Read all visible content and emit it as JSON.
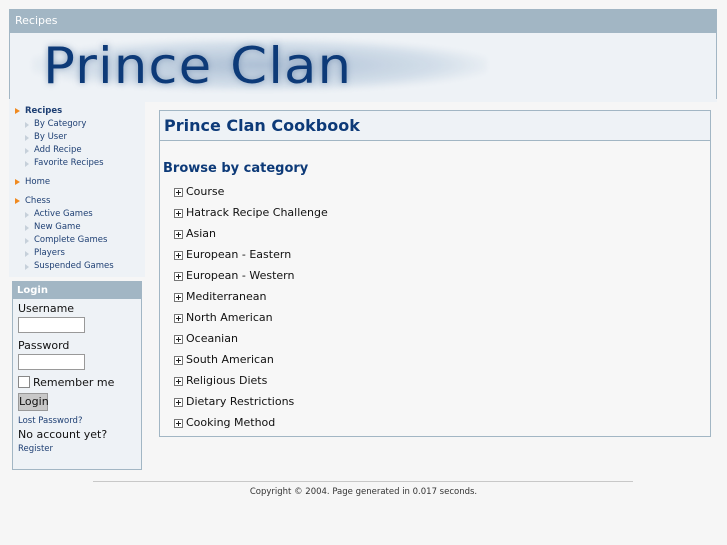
{
  "header": {
    "section_title": "Recipes",
    "banner_text": "Prince Clan"
  },
  "sidebar": {
    "nav": [
      {
        "label": "Recipes",
        "bold": true,
        "children": [
          "By Category",
          "By User",
          "Add Recipe",
          "Favorite Recipes"
        ]
      },
      {
        "label": "Home",
        "bold": false,
        "children": []
      },
      {
        "label": "Chess",
        "bold": false,
        "children": [
          "Active Games",
          "New Game",
          "Complete Games",
          "Players",
          "Suspended Games"
        ]
      }
    ],
    "login": {
      "title": "Login",
      "username_label": "Username",
      "username_value": "",
      "password_label": "Password",
      "password_value": "",
      "remember_label": "Remember me",
      "remember_checked": false,
      "login_button": "Login",
      "lost_password": "Lost Password?",
      "no_account": "No account yet?",
      "register": "Register"
    }
  },
  "main": {
    "title": "Prince Clan Cookbook",
    "browse_heading": "Browse by category",
    "categories": [
      "Course",
      "Hatrack Recipe Challenge",
      "Asian",
      "European - Eastern",
      "European - Western",
      "Mediterranean",
      "North American",
      "Oceanian",
      "South American",
      "Religious Diets",
      "Dietary Restrictions",
      "Cooking Method"
    ]
  },
  "footer": {
    "text": "Copyright © 2004. Page generated in 0.017 seconds."
  },
  "colors": {
    "accent_bar": "#a2b6c4",
    "panel_bg": "#eef2f6",
    "heading_blue": "#0d3a78",
    "link_blue": "#1e3f73",
    "nav_arrow": "#f08a20"
  }
}
